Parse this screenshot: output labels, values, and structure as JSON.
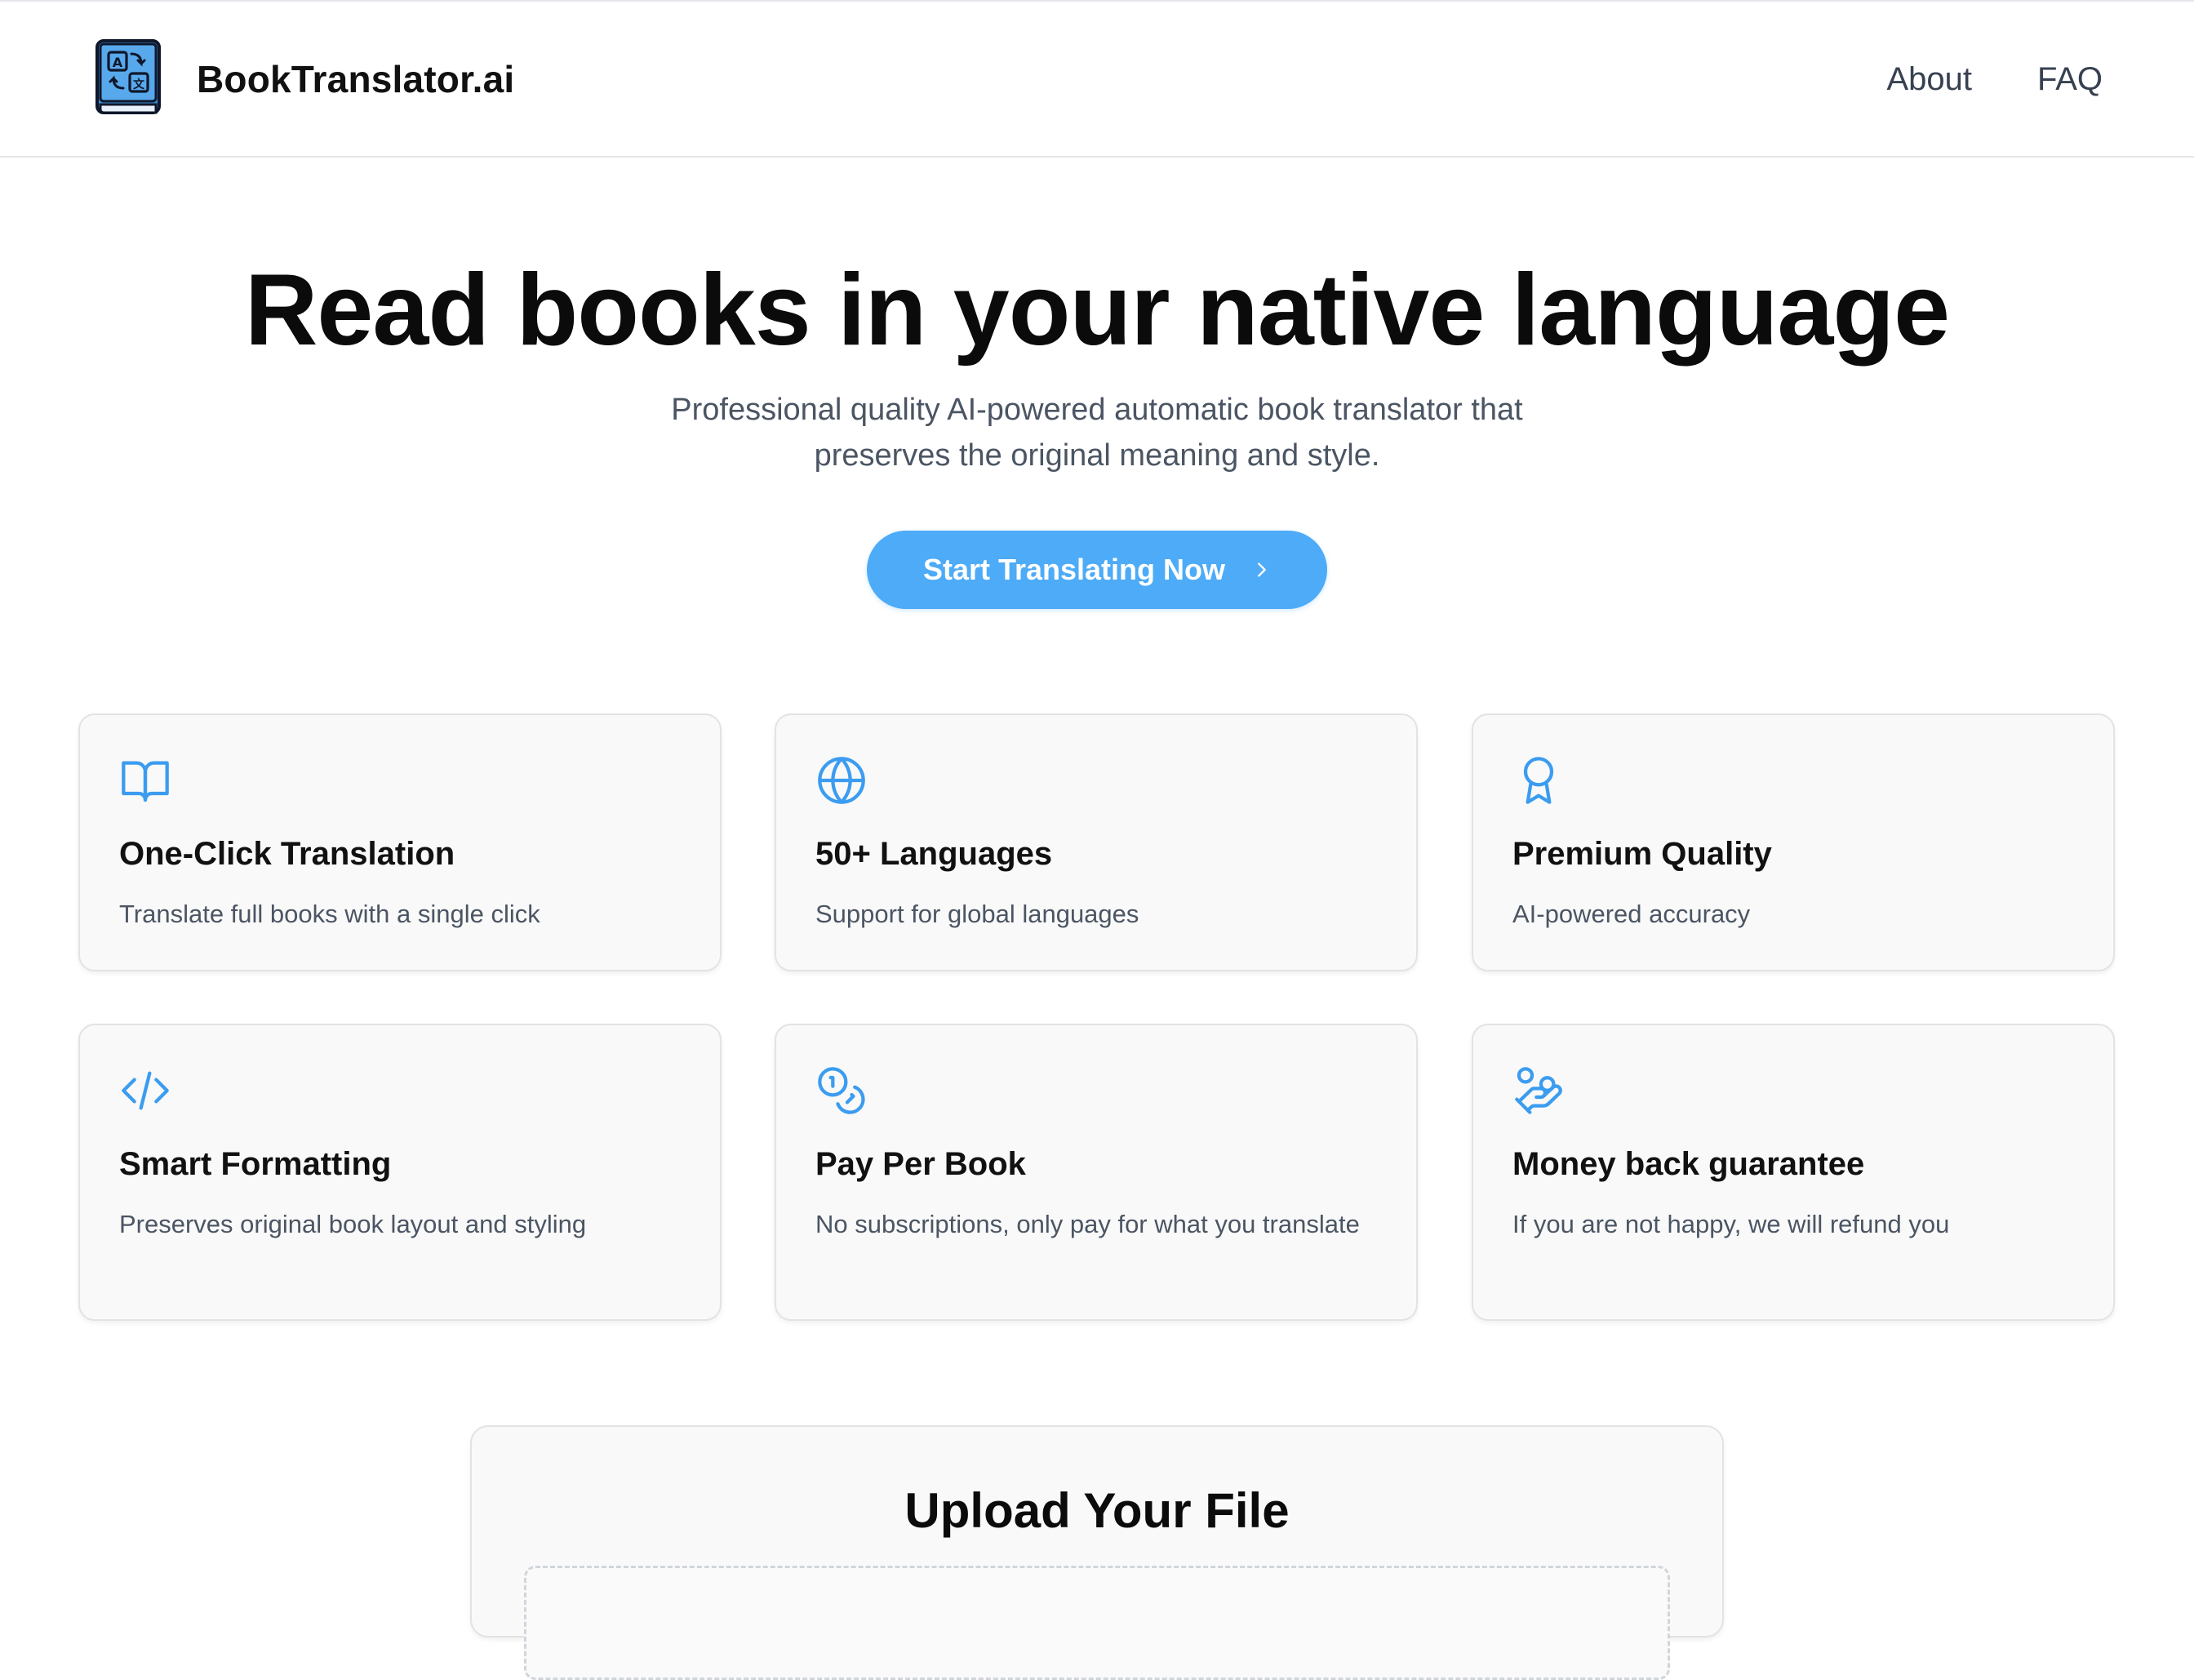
{
  "header": {
    "brand_name": "BookTranslator.ai",
    "nav": [
      {
        "label": "About"
      },
      {
        "label": "FAQ"
      }
    ]
  },
  "hero": {
    "title": "Read books in your native language",
    "subtitle": "Professional quality AI-powered automatic book translator that preserves the original meaning and style.",
    "cta_label": "Start Translating Now",
    "cta_icon": "chevron-right-icon"
  },
  "features": [
    {
      "icon": "book-open-icon",
      "title": "One-Click Translation",
      "description": "Translate full books with a single click"
    },
    {
      "icon": "globe-icon",
      "title": "50+ Languages",
      "description": "Support for global languages"
    },
    {
      "icon": "award-icon",
      "title": "Premium Quality",
      "description": "AI-powered accuracy"
    },
    {
      "icon": "code-icon",
      "title": "Smart Formatting",
      "description": "Preserves original book layout and styling"
    },
    {
      "icon": "coins-icon",
      "title": "Pay Per Book",
      "description": "No subscriptions, only pay for what you translate"
    },
    {
      "icon": "hand-coins-icon",
      "title": "Money back guarantee",
      "description": "If you are not happy, we will refund you"
    }
  ],
  "upload": {
    "title": "Upload Your File"
  },
  "colors": {
    "accent": "#4dabf7",
    "icon": "#3b9cf0",
    "logo_book": "#3d8fd6",
    "text_muted": "#4b5563"
  }
}
